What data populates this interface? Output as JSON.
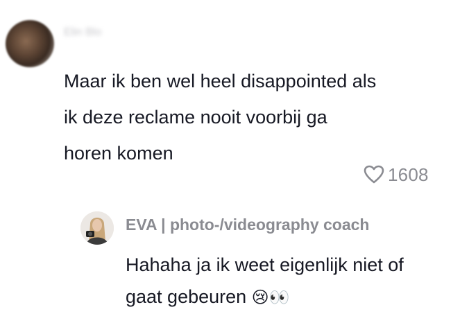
{
  "comment": {
    "username": "Elin Blo",
    "text_lines": [
      "Maar ik ben wel heel disappointed als",
      "ik deze reclame nooit voorbij ga",
      "horen komen"
    ],
    "like_icon": "heart-outline-icon",
    "like_count": "1608"
  },
  "reply": {
    "author": "EVA | photo-/videography coach",
    "text_lines": [
      "Hahaha ja ik weet eigenlijk niet of",
      "gaat gebeuren"
    ],
    "emojis": "😢👀"
  }
}
